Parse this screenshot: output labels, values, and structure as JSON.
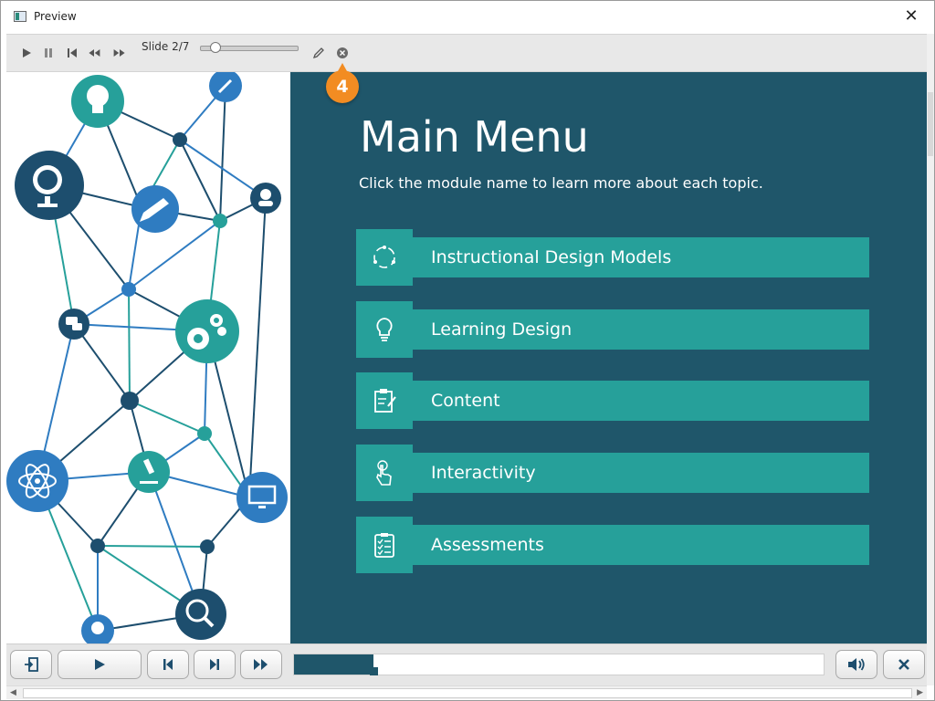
{
  "window": {
    "title": "Preview",
    "close_glyph": "✕"
  },
  "toolbar": {
    "slide_label": "Slide 2/7",
    "slider_fraction": 0.14,
    "icons": [
      "play-icon",
      "pause-icon",
      "skip-to-start-icon",
      "rewind-icon",
      "fast-forward-icon",
      "pencil-icon",
      "close-circle-icon"
    ]
  },
  "callout_badge": "4",
  "slide": {
    "title": "Main Menu",
    "subtitle": "Click the module name to learn more about each topic.",
    "menu": [
      {
        "label": "Instructional Design Models",
        "icon": "cycle-arrows-icon"
      },
      {
        "label": "Learning Design",
        "icon": "lightbulb-icon"
      },
      {
        "label": "Content",
        "icon": "clipboard-edit-icon"
      },
      {
        "label": "Interactivity",
        "icon": "touch-hand-icon"
      },
      {
        "label": "Assessments",
        "icon": "checklist-icon"
      }
    ]
  },
  "player": {
    "progress_fraction": 0.15,
    "buttons": [
      "exit-icon",
      "play-icon",
      "previous-icon",
      "next-icon",
      "fast-forward-icon",
      "volume-icon",
      "close-icon"
    ]
  },
  "colors": {
    "slide_bg": "#1f566a",
    "teal": "#26a09a",
    "navy": "#1d4e6e",
    "blue": "#2f7cc1",
    "badge": "#f28c22"
  }
}
